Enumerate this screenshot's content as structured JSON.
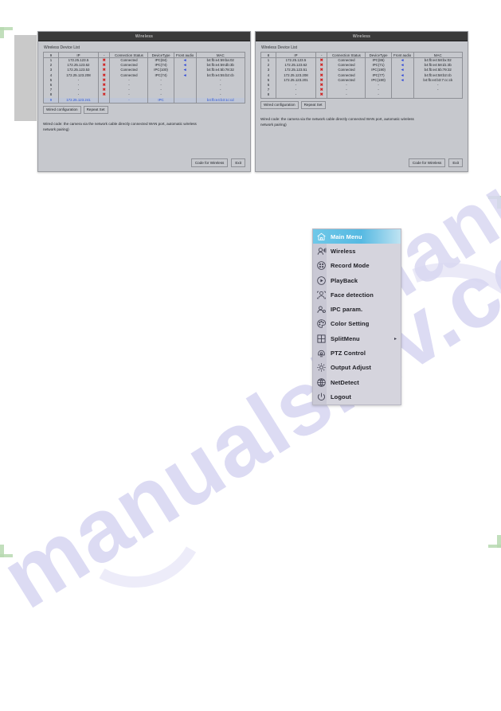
{
  "watermark": {
    "text": "manualshiv.com"
  },
  "dialogs": [
    {
      "id": "wireless-left",
      "title": "Wireless",
      "list_label": "Wireless Device List",
      "columns": [
        "9",
        "IP",
        "-",
        "Connection Status",
        "DeviceType",
        "Front audio",
        "MAC"
      ],
      "rows": [
        {
          "id": "1",
          "ip": "172.25.123.5",
          "x": "✖",
          "status": "Connected",
          "type": "IPC(84)",
          "audio": "◄",
          "mac": "b4:fb:e4:59:ba:02"
        },
        {
          "id": "2",
          "ip": "172.25.123.62",
          "x": "✖",
          "status": "Connected",
          "type": "IPC(74)",
          "audio": "◄",
          "mac": "b4:fb:e4:59:db:3b"
        },
        {
          "id": "3",
          "ip": "172.25.123.53",
          "x": "✖",
          "status": "Connected",
          "type": "IPC(100)",
          "audio": "◄",
          "mac": "b4:fb:e4:5b:78:32"
        },
        {
          "id": "4",
          "ip": "172.25.123.208",
          "x": "✖",
          "status": "Connected",
          "type": "IPC(74)",
          "audio": "◄",
          "mac": "b4:fb:e4:55:b2:cb"
        },
        {
          "id": "5",
          "ip": "-",
          "x": "✖",
          "status": "-",
          "type": "-",
          "audio": "",
          "mac": "-"
        },
        {
          "id": "6",
          "ip": "-",
          "x": "✖",
          "status": "-",
          "type": "-",
          "audio": "",
          "mac": "-"
        },
        {
          "id": "7",
          "ip": "-",
          "x": "✖",
          "status": "-",
          "type": "-",
          "audio": "",
          "mac": "-"
        },
        {
          "id": "8",
          "ip": "-",
          "x": "✖",
          "status": "-",
          "type": "-",
          "audio": "",
          "mac": "-"
        },
        {
          "id": "9",
          "ip": "172.25.123.241",
          "x": "",
          "status": "-",
          "type": "IPC",
          "audio": "",
          "mac": "b4:fb:e4:b3:1c:cd",
          "selected": true
        }
      ],
      "tabs": [
        "Wired configuration",
        "Repeat Set"
      ],
      "description": "Wired code: the camera via the network cable directly connected WAN port, automatic wireless network pairing)",
      "buttons": [
        "Code for Wireless",
        "Exit"
      ]
    },
    {
      "id": "wireless-right",
      "title": "Wireless",
      "list_label": "Wireless Device List",
      "columns": [
        "8",
        "IP",
        "-",
        "Connection Status",
        "DeviceType",
        "Front audio",
        "MAC"
      ],
      "rows": [
        {
          "id": "1",
          "ip": "172.25.123.5",
          "x": "✖",
          "status": "Connected",
          "type": "IPC(86)",
          "audio": "◄",
          "mac": "b4:fb:e4:58:bx:02"
        },
        {
          "id": "2",
          "ip": "172.25.123.62",
          "x": "✖",
          "status": "Connected",
          "type": "IPC(71)",
          "audio": "◄",
          "mac": "b4:fb:e4:58:d1:3b"
        },
        {
          "id": "3",
          "ip": "172.25.123.51",
          "x": "✖",
          "status": "Connected",
          "type": "IPC(190)",
          "audio": "◄",
          "mac": "b4:fb:e4:5b:79:32"
        },
        {
          "id": "4",
          "ip": "172.25.123.208",
          "x": "✖",
          "status": "Connected",
          "type": "IPC(77)",
          "audio": "◄",
          "mac": "b4:fb:e4:58:b2:cb"
        },
        {
          "id": "5",
          "ip": "172.25.123.201",
          "x": "✖",
          "status": "Connected",
          "type": "IPC(190)",
          "audio": "◄",
          "mac": "b4:fb:e4:b3:7:cc:ck"
        },
        {
          "id": "6",
          "ip": "-",
          "x": "✖",
          "status": "-",
          "type": "-",
          "audio": "",
          "mac": "-"
        },
        {
          "id": "7",
          "ip": "-",
          "x": "✖",
          "status": "-",
          "type": "-",
          "audio": "",
          "mac": "-"
        },
        {
          "id": "8",
          "ip": "-",
          "x": "✖",
          "status": "-",
          "type": "-",
          "audio": "",
          "mac": ""
        }
      ],
      "tabs": [
        "Wired configuration",
        "Repeat Set"
      ],
      "description": "Wired code: the camera via the network cable directly connected WAN port, automatic wireless network pairing)",
      "buttons": [
        "Code for Wireless",
        "Exit"
      ]
    }
  ],
  "menu": {
    "items": [
      {
        "label": "Main Menu",
        "icon": "home-icon",
        "active": true
      },
      {
        "label": "Wireless",
        "icon": "wireless-icon"
      },
      {
        "label": "Record Mode",
        "icon": "record-mode-icon"
      },
      {
        "label": "PlayBack",
        "icon": "playback-icon"
      },
      {
        "label": "Face detection",
        "icon": "face-detection-icon"
      },
      {
        "label": "IPC param.",
        "icon": "ipc-param-icon"
      },
      {
        "label": "Color Setting",
        "icon": "color-setting-icon"
      },
      {
        "label": "SplitMenu",
        "icon": "split-menu-icon",
        "arrow": "▸"
      },
      {
        "label": "PTZ Control",
        "icon": "ptz-control-icon"
      },
      {
        "label": "Output Adjust",
        "icon": "output-adjust-icon"
      },
      {
        "label": "NetDetect",
        "icon": "net-detect-icon"
      },
      {
        "label": "Logout",
        "icon": "logout-icon"
      }
    ]
  },
  "colors": {
    "dialog_bg": "#c6c8cd",
    "titlebar": "#3a3a3a",
    "accent_highlight": "#56b9e2",
    "error_red": "#d02020",
    "link_blue": "#2a55d8",
    "watermark": "#d9d8f2"
  }
}
